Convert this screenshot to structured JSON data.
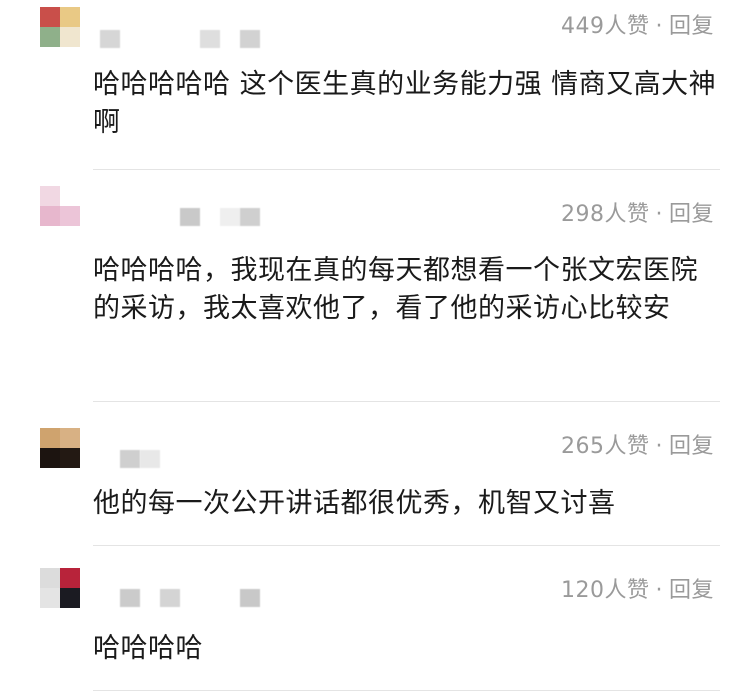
{
  "comments": [
    {
      "likes": "449人赞",
      "separator": "·",
      "reply": "回复",
      "text": "哈哈哈哈哈 这个医生真的业务能力强 情商又高大神啊",
      "avatar_colors": [
        "#c94f4a",
        "#e9c985",
        "#8fb08a",
        "#f0e6cf"
      ],
      "name_blocks": [
        "#d6d6d6",
        "#dedede",
        "#d2d2d2"
      ]
    },
    {
      "likes": "298人赞",
      "separator": "·",
      "reply": "回复",
      "text": "哈哈哈哈，我现在真的每天都想看一个张文宏医院的采访，我太喜欢他了，看了他的采访心比较安",
      "avatar_colors": [
        "#f1d8e3",
        "#ffffff",
        "#e7b7cd",
        "#ecc5d8"
      ],
      "name_blocks": [
        "#c9c9c9",
        "#efefef",
        "#cfcfcf"
      ]
    },
    {
      "likes": "265人赞",
      "separator": "·",
      "reply": "回复",
      "text": "他的每一次公开讲话都很优秀，机智又讨喜",
      "avatar_colors": [
        "#cfa36e",
        "#d8b184",
        "#1c1410",
        "#231913"
      ],
      "name_blocks": [
        "#cfcfcf",
        "#e8e8e8"
      ]
    },
    {
      "likes": "120人赞",
      "separator": "·",
      "reply": "回复",
      "text": "哈哈哈哈",
      "avatar_colors": [
        "#dcdcdc",
        "#b8233a",
        "#e4e4e4",
        "#1b1b22"
      ],
      "name_blocks": [
        "#cbcbcb",
        "#d4d4d4",
        "#c8c8c8"
      ]
    }
  ]
}
